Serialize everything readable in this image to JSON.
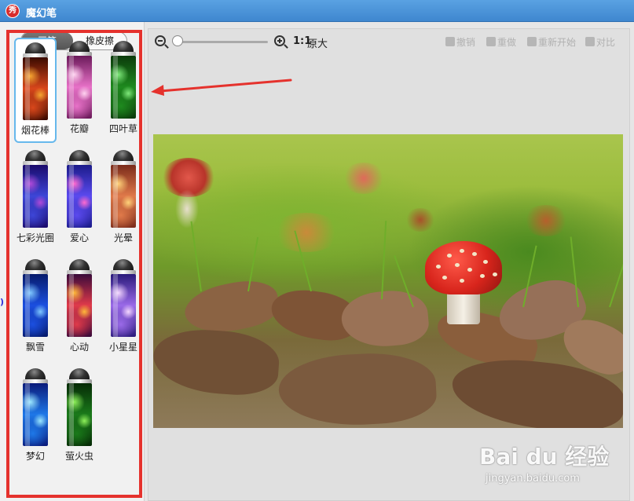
{
  "window": {
    "title": "魔幻笔",
    "logo_text": "秀"
  },
  "mode_tabs": {
    "brush": "画笔",
    "eraser": "橡皮擦",
    "selected": "brush"
  },
  "brushes": [
    {
      "label": "烟花棒",
      "colors": [
        "#3a0a00",
        "#d9471b",
        "#f6a531"
      ],
      "selected": true
    },
    {
      "label": "花瓣",
      "colors": [
        "#6b1a5a",
        "#e872c8",
        "#ffd3f0"
      ]
    },
    {
      "label": "四叶草",
      "colors": [
        "#0b3a0b",
        "#1e8a1e",
        "#7ee87a"
      ]
    },
    {
      "label": "七彩光圈",
      "colors": [
        "#1a0a6b",
        "#3d46d8",
        "#b04ad8"
      ]
    },
    {
      "label": "爱心",
      "colors": [
        "#1b1b8a",
        "#5b4aef",
        "#ff6bd0"
      ]
    },
    {
      "label": "光晕",
      "colors": [
        "#7a2b1a",
        "#e07a4a",
        "#ffd27a"
      ]
    },
    {
      "label": "飘雪",
      "colors": [
        "#061a6b",
        "#1b4fe0",
        "#7ec6ff"
      ]
    },
    {
      "label": "心动",
      "colors": [
        "#3a0a3a",
        "#e03a4a",
        "#ffb83a"
      ]
    },
    {
      "label": "小星星",
      "colors": [
        "#2a1a7a",
        "#9a6ae8",
        "#f4d7ff"
      ]
    },
    {
      "label": "梦幻",
      "colors": [
        "#0a1a7a",
        "#1e78e8",
        "#9ae6ff"
      ]
    },
    {
      "label": "萤火虫",
      "colors": [
        "#062a06",
        "#1a7a1a",
        "#8ef05a"
      ]
    }
  ],
  "toolbar": {
    "ratio": "1:1",
    "original": "原大",
    "undo": "撤销",
    "redo": "重做",
    "restart": "重新开始",
    "compare": "对比"
  },
  "watermark": {
    "brand": "Bai du 经验",
    "url": "jingyan.baidu.com"
  },
  "colors": {
    "highlight_box": "#e5322d",
    "arrow": "#e5322d",
    "titlebar": "#4a92d8",
    "selection": "#66b8ec"
  }
}
